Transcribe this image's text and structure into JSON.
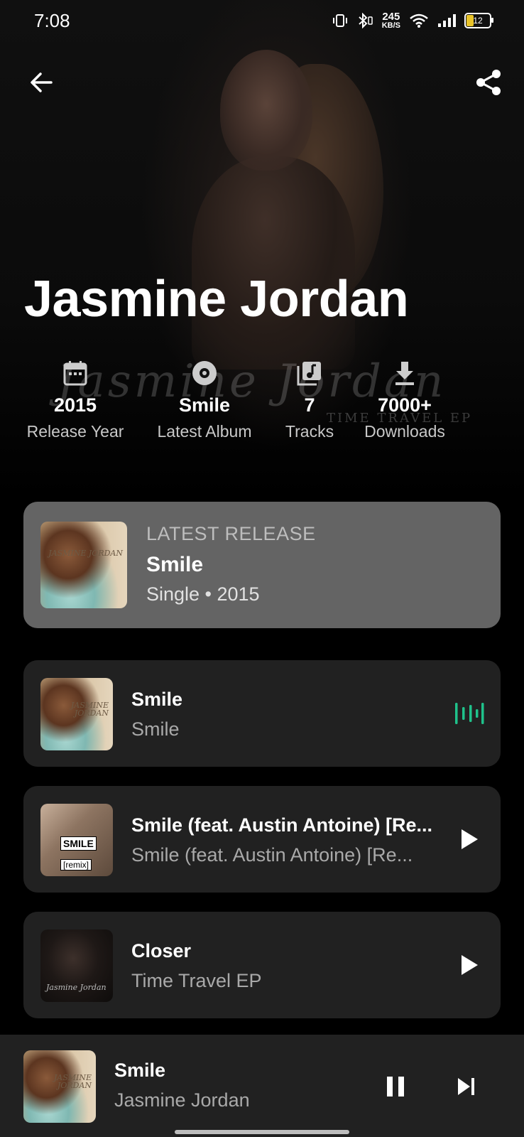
{
  "status_bar": {
    "time": "7:08",
    "net_speed_value": "245",
    "net_speed_unit": "KB/S",
    "battery": "12"
  },
  "artist": {
    "name": "Jasmine Jordan",
    "watermark": "Jasmine Jordan",
    "watermark_sub": "TIME TRAVEL EP"
  },
  "stats": [
    {
      "icon": "calendar-icon",
      "value": "2015",
      "label": "Release Year"
    },
    {
      "icon": "disc-icon",
      "value": "Smile",
      "label": "Latest Album"
    },
    {
      "icon": "music-library-icon",
      "value": "7",
      "label": "Tracks"
    },
    {
      "icon": "download-icon",
      "value": "7000+",
      "label": "Downloads"
    }
  ],
  "latest_release": {
    "tag": "LATEST RELEASE",
    "title": "Smile",
    "meta": "Single • 2015",
    "art_text": "JASMINE JORDAN"
  },
  "tracks": [
    {
      "title": "Smile",
      "subtitle": "Smile",
      "state": "playing",
      "art_text": "JASMINE JORDAN"
    },
    {
      "title": "Smile (feat. Austin Antoine) [Re...",
      "subtitle": "Smile (feat. Austin Antoine) [Re...",
      "state": "play",
      "art_label": "SMILE",
      "art_label2": "[remix]"
    },
    {
      "title": "Closer",
      "subtitle": "Time Travel EP",
      "state": "play",
      "art_sig": "Jasmine Jordan"
    }
  ],
  "player": {
    "title": "Smile",
    "artist": "Jasmine Jordan",
    "art_text": "JASMINE JORDAN"
  },
  "colors": {
    "accent_green": "#1fc28b",
    "card_bg": "#212121",
    "latest_bg": "#646464"
  }
}
